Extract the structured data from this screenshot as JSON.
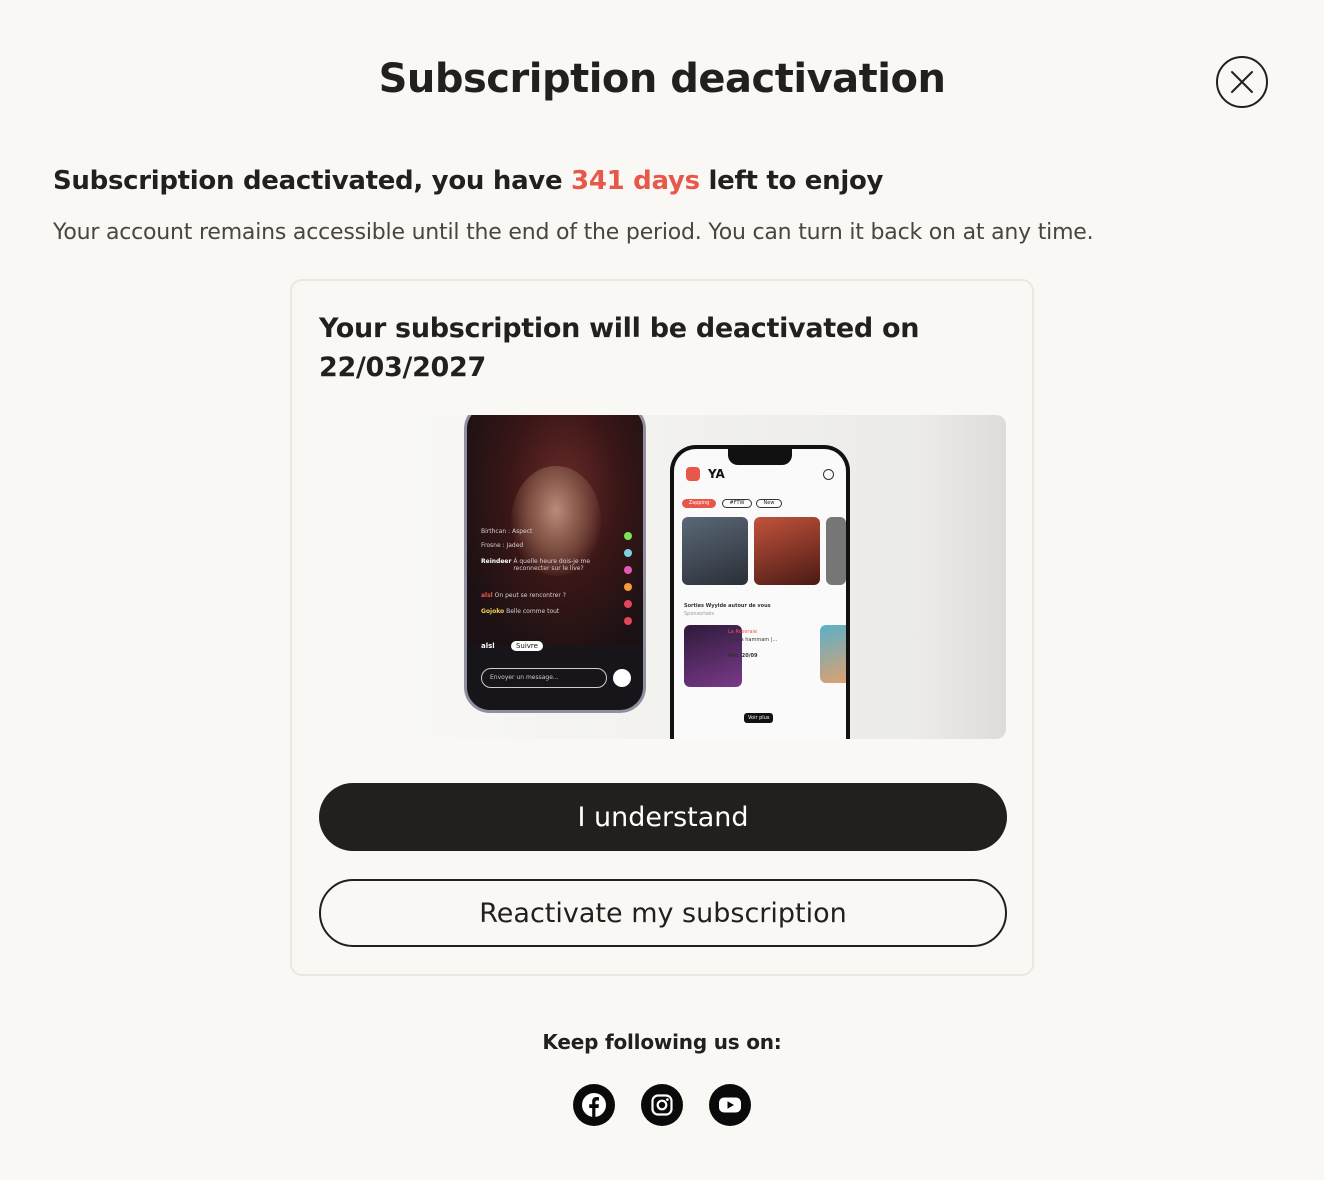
{
  "modal": {
    "title": "Subscription deactivation",
    "close_icon": "close-icon"
  },
  "status": {
    "headline_prefix": "Subscription deactivated, you have ",
    "days_left": "341 days",
    "headline_suffix": " left to enjoy",
    "accent_color": "#e8584a",
    "description": "Your account remains accessible until the end of the period. You can turn it back on at any time."
  },
  "card": {
    "title": "Your subscription will be deactivated on 22/03/2027",
    "promo": {
      "left_phone": {
        "chat": [
          {
            "user": "",
            "text": "Birthcan : Aspect"
          },
          {
            "user": "",
            "text": "Frosne : Jaded"
          },
          {
            "user": "Reindeer",
            "text": "À quelle heure dois-je me reconnecter sur le live?"
          },
          {
            "user": "alsl",
            "text": "On peut se rencontrer ?"
          },
          {
            "user": "Gojoko",
            "text": "Belle comme tout"
          }
        ],
        "username": "alsl",
        "follow_label": "Suivre",
        "message_placeholder": "Envoyer un message..."
      },
      "right_phone": {
        "logo": "YA",
        "chips": [
          "Zapping",
          "#FTW",
          "New"
        ],
        "section_title": "Sorties Wyylde autour de vous",
        "sponsored": "Sponsorisés",
        "event_name": "La Roseraie",
        "event_desc": "Sauna hammam |...",
        "event_date": "Mer. 20/09",
        "see_more": "Voir plus"
      }
    },
    "primary_button": "I understand",
    "secondary_button": "Reactivate my subscription"
  },
  "footer": {
    "follow_label": "Keep following us on:",
    "socials": [
      {
        "name": "facebook",
        "icon": "facebook-icon"
      },
      {
        "name": "instagram",
        "icon": "instagram-icon"
      },
      {
        "name": "youtube",
        "icon": "youtube-icon"
      }
    ]
  }
}
